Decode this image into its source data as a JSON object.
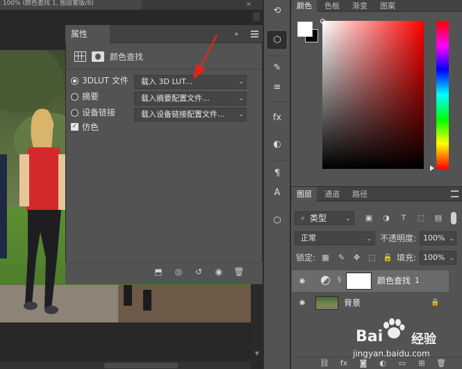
{
  "document": {
    "tab_title": "100% (颜色查找 1, 图层蒙版/8)",
    "close_glyph": "×"
  },
  "properties_panel": {
    "tab_label": "属性",
    "collapse_glyph": "»",
    "adjustment_title": "颜色查找",
    "options": [
      {
        "label": "3DLUT 文件",
        "selected": true,
        "dropdown": "载入 3D LUT..."
      },
      {
        "label": "摘要",
        "selected": false,
        "dropdown": "载入摘要配置文件..."
      },
      {
        "label": "设备链接",
        "selected": false,
        "dropdown": "载入设备链接配置文件..."
      }
    ],
    "dither": {
      "label": "仿色",
      "checked": true,
      "check_glyph": "✓"
    },
    "footer_icons": [
      "clip-to-layer-icon",
      "view-previous-icon",
      "reset-icon",
      "visibility-icon",
      "trash-icon"
    ],
    "arrow_glyph": "⌄"
  },
  "toolbar": {
    "tools": [
      "history-icon",
      "3d-cube-icon",
      "brush-settings-icon",
      "adjustments-icon",
      "fx-icon",
      "clone-source-icon",
      "paragraph-icon",
      "character-icon",
      "3d-object-icon"
    ],
    "glyphs": {
      "history": "⟲",
      "brush": "✎",
      "sliders": "≡",
      "fx": "fx",
      "clone": "◐",
      "paragraph": "¶",
      "character": "A",
      "cube": "⬡"
    }
  },
  "color_panel": {
    "tabs": [
      "颜色",
      "色板",
      "渐变",
      "图案"
    ],
    "active_tab": "颜色",
    "foreground": "#ffffff",
    "background": "#000000",
    "hue": "#ff0000"
  },
  "layers_panel": {
    "tabs": [
      "图层",
      "通道",
      "路径"
    ],
    "active_tab": "图层",
    "filter_label": "类型",
    "filter_glyphs": {
      "search": "⌕",
      "arrow": "⌄"
    },
    "filter_icons": {
      "image": "▣",
      "adjustment": "◑",
      "type": "T",
      "shape": "⬚",
      "smart": "▤"
    },
    "blend_mode": "正常",
    "opacity_label": "不透明度:",
    "opacity_value": "100%",
    "lock_label": "锁定:",
    "lock_icons": {
      "pixels": "▦",
      "paint": "✎",
      "move": "✥",
      "artboard": "⬚",
      "all": "🔒"
    },
    "fill_label": "填充:",
    "fill_value": "100%",
    "eye_glyph": "◉",
    "chain_glyph": "§",
    "lock_glyph": "🔒",
    "layers": [
      {
        "name": "颜色查找",
        "suffix": "1",
        "visible": true,
        "selected": true
      },
      {
        "name": "背景",
        "visible": true,
        "selected": false,
        "locked": true
      }
    ],
    "footer_buttons": {
      "link": "⛓",
      "fx": "fx",
      "mask": "◙",
      "adjustment": "◐",
      "group": "▭",
      "new": "⊞",
      "delete": "🗑"
    }
  },
  "watermark": {
    "text": "Bai",
    "suffix": "经验",
    "url": "jingyan.baidu.com"
  }
}
